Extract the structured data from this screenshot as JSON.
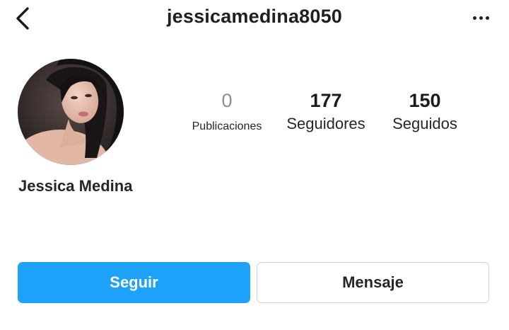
{
  "header": {
    "username": "jessicamedina8050",
    "back_icon": "chevron-left-icon",
    "more_icon": "more-horizontal-icon"
  },
  "profile": {
    "display_name": "Jessica Medina",
    "avatar": "profile-photo"
  },
  "stats": {
    "posts": {
      "value": "0",
      "label": "Publicaciones"
    },
    "followers": {
      "value": "177",
      "label": "Seguidores"
    },
    "following": {
      "value": "150",
      "label": "Seguidos"
    }
  },
  "actions": {
    "follow_label": "Seguir",
    "message_label": "Mensaje"
  },
  "colors": {
    "follow_button": "#1da1f9",
    "message_border": "#d3d3d3",
    "zero_count": "#8e8e8e"
  }
}
